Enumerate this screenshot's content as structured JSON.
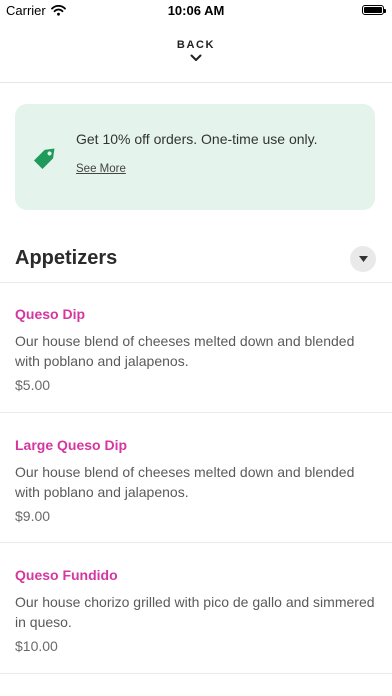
{
  "status_bar": {
    "carrier": "Carrier",
    "time": "10:06 AM"
  },
  "nav": {
    "back_label": "BACK"
  },
  "promo": {
    "text": "Get 10% off orders. One-time use only.",
    "link": "See More",
    "accent": "#1f9a5a",
    "background": "#e4f4ec"
  },
  "section": {
    "title": "Appetizers"
  },
  "items": [
    {
      "name": "Queso Dip",
      "description": "Our house blend of cheeses melted down and blended with poblano and jalapenos.",
      "price": "$5.00"
    },
    {
      "name": "Large Queso Dip",
      "description": "Our house blend of cheeses melted down and blended with poblano and jalapenos.",
      "price": "$9.00"
    },
    {
      "name": "Queso Fundido",
      "description": "Our house chorizo grilled with pico de gallo and simmered in queso.",
      "price": "$10.00"
    }
  ],
  "colors": {
    "item_name": "#d6369f"
  }
}
